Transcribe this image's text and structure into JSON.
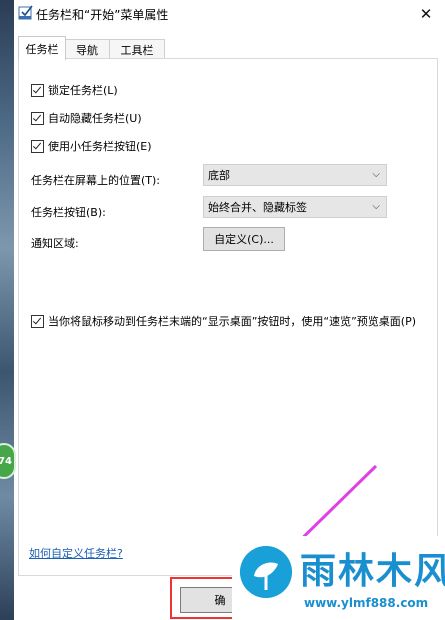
{
  "window": {
    "title": "任务栏和“开始”菜单属性",
    "close_glyph": "✕"
  },
  "tabs": [
    "任务栏",
    "导航",
    "工具栏"
  ],
  "checkboxes": {
    "lock": "锁定任务栏(L)",
    "autohide": "自动隐藏任务栏(U)",
    "small_buttons": "使用小任务栏按钮(E)",
    "peek": "当你将鼠标移动到任务栏末端的“显示桌面”按钮时，使用“速览”预览桌面(P)"
  },
  "settings": {
    "location_label": "任务栏在屏幕上的位置(T):",
    "location_value": "底部",
    "buttons_label": "任务栏按钮(B):",
    "buttons_value": "始终合并、隐藏标签",
    "notify_label": "通知区域:",
    "customize_button": "自定义(C)..."
  },
  "help_link": "如何自定义任务栏?",
  "ok_button": "确",
  "badge_text": "74",
  "watermark": {
    "title": "雨林木风",
    "url": "www.ylmf888.com"
  },
  "colors": {
    "accent": "#1a8fd0",
    "arrow": "#e040e8",
    "highlight": "#e33333",
    "link": "#1a5fb4"
  }
}
